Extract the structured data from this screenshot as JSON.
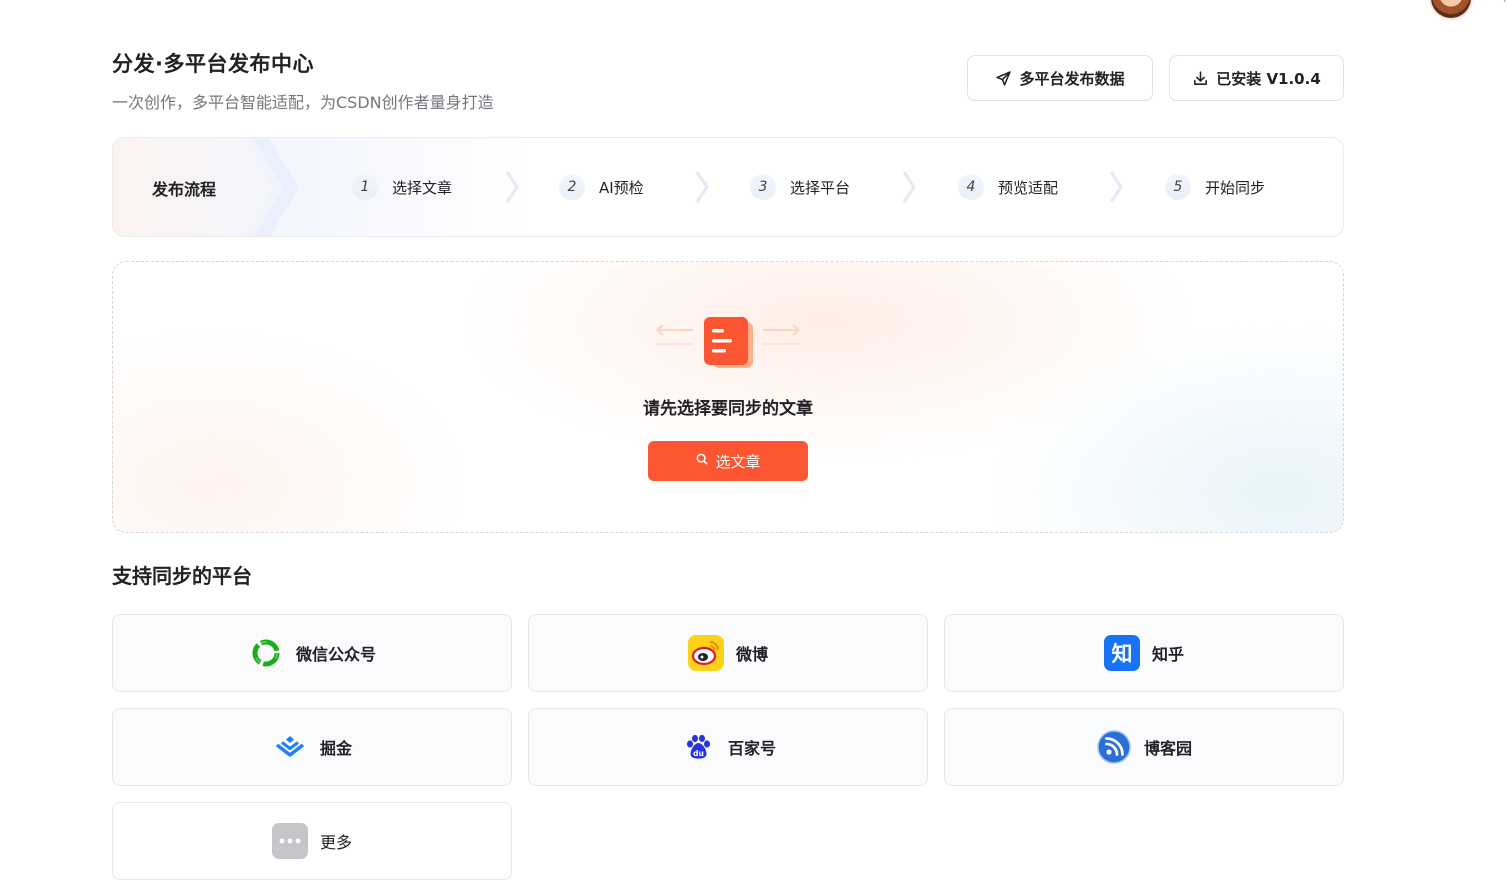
{
  "header": {
    "title": "分发·多平台发布中心",
    "subtitle": "一次创作，多平台智能适配，为CSDN创作者量身打造",
    "data_button": "多平台发布数据",
    "install_button": "已安装 V1.0.4"
  },
  "flow": {
    "title": "发布流程",
    "steps": [
      {
        "num": "1",
        "label": "选择文章"
      },
      {
        "num": "2",
        "label": "AI预检"
      },
      {
        "num": "3",
        "label": "选择平台"
      },
      {
        "num": "4",
        "label": "预览适配"
      },
      {
        "num": "5",
        "label": "开始同步"
      }
    ]
  },
  "empty_state": {
    "message": "请先选择要同步的文章",
    "button": "选文章"
  },
  "platforms": {
    "title": "支持同步的平台",
    "items": [
      {
        "label": "微信公众号",
        "icon": "wechat-official-icon"
      },
      {
        "label": "微博",
        "icon": "weibo-icon"
      },
      {
        "label": "知乎",
        "icon": "zhihu-icon",
        "icon_text": "知"
      },
      {
        "label": "掘金",
        "icon": "juejin-icon"
      },
      {
        "label": "百家号",
        "icon": "baijiahao-icon",
        "icon_text": "du"
      },
      {
        "label": "博客园",
        "icon": "cnblogs-icon"
      },
      {
        "label": "更多",
        "icon": "more-icon"
      }
    ]
  },
  "colors": {
    "accent": "#fc5531",
    "zhihu": "#1772f6",
    "wechat": "#1aad19",
    "juejin": "#1e80ff",
    "baijiahao": "#2932e1",
    "cnblogs": "#2b6fd6"
  }
}
